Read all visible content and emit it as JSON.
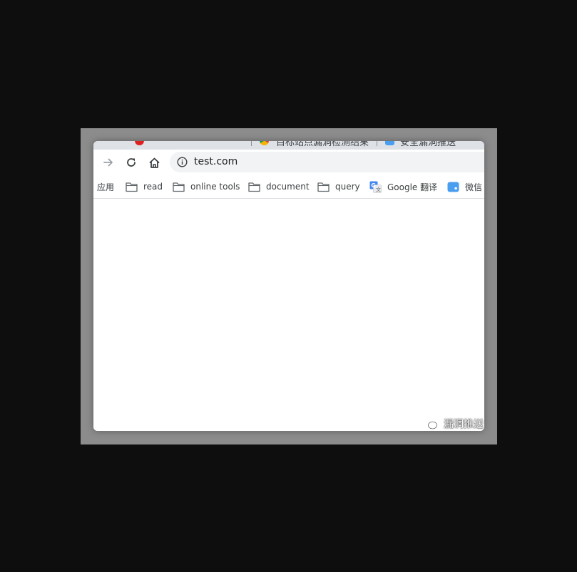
{
  "tabs": [
    {
      "title": "",
      "favicon": "red-circle-icon",
      "color": "#e02020"
    },
    {
      "title": "目标站点漏洞检测结果",
      "favicon": "chrome-icon"
    },
    {
      "title": "安全漏洞推送",
      "favicon": "blue-square-icon",
      "color": "#4a9ef0"
    }
  ],
  "toolbar": {
    "url": "test.com"
  },
  "bookmarks": [
    {
      "label": "应用",
      "icon": "apps-icon"
    },
    {
      "label": "read",
      "icon": "folder-icon"
    },
    {
      "label": "online tools",
      "icon": "folder-icon"
    },
    {
      "label": "document",
      "icon": "folder-icon"
    },
    {
      "label": "query",
      "icon": "folder-icon"
    },
    {
      "label": "Google 翻译",
      "icon": "google-translate-icon"
    },
    {
      "label": "微信",
      "icon": "wechat-icon"
    }
  ],
  "watermark": {
    "text": "漏洞推送",
    "icon": "wechat-logo-icon"
  },
  "colors": {
    "page_background": "#0e0e0e",
    "frame": "#8c8c8c",
    "tabstrip": "#dee1e6",
    "omnibox": "#f1f3f4",
    "accent_blue": "#1a73e8"
  }
}
